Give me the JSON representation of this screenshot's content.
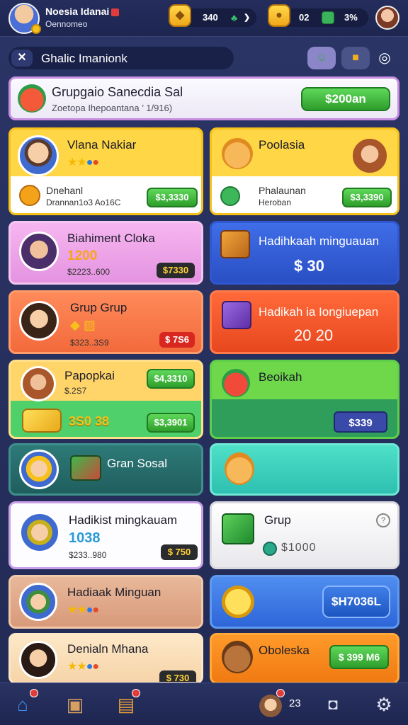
{
  "header": {
    "player_name": "Noesia Idanai",
    "player_sub": "Oennomeo",
    "res1_value": "340",
    "res2_value": "02",
    "res3_value": "3%"
  },
  "titlebar": {
    "title": "Ghalic Imanionk"
  },
  "banner": {
    "title": "Grupgaio Sanecdia Sal",
    "subtitle": "Zoetopa Ihepoantana ’ 1/916)",
    "button": "$200an"
  },
  "cards": {
    "c1": {
      "title": "Vlana Nakiar",
      "sub1": "Dnehanl",
      "sub2": "Drannan1o3 Ao16C",
      "price": "$3,3330"
    },
    "c2": {
      "title": "Poolasia",
      "sub1": "Phalaunan",
      "sub2": "Heroban",
      "price": "$3,3390"
    },
    "c3": {
      "title": "Biahiment Cloka",
      "amount": "1200",
      "sub": "$2223..600",
      "price": "$7330"
    },
    "c4": {
      "title": "Hadihkaah minguauan",
      "amount": "$ 30"
    },
    "c5": {
      "title": "Grup Grup",
      "sub": "$323..3S9",
      "price": "$ 7S6"
    },
    "c6": {
      "title": "Hadikah ia Iongiuepan",
      "amount": "20 20"
    },
    "c7": {
      "title": "Papopkai",
      "sub": "$.2S7",
      "price_top": "$4,3310",
      "amount": "3S0 38",
      "price_bottom": "$3,3901"
    },
    "c8": {
      "title": "Beoikah",
      "price": "$339"
    },
    "c9": {
      "title": "Gran Sosal"
    },
    "c10": {
      "title": "Hadikist mingkauam",
      "amount": "1038",
      "sub": "$233..980",
      "price": "$ 750"
    },
    "c11": {
      "title": "Grup",
      "amount": "$1000"
    },
    "c12": {
      "title": "Hadiaak Minguan"
    },
    "c13": {
      "button": "$H7036L"
    },
    "c14": {
      "title": "Denialn Mhana",
      "price": "$ 730"
    },
    "c15": {
      "title": "Oboleska",
      "price": "$ 399 M6"
    }
  },
  "nav": {
    "count": "23"
  }
}
